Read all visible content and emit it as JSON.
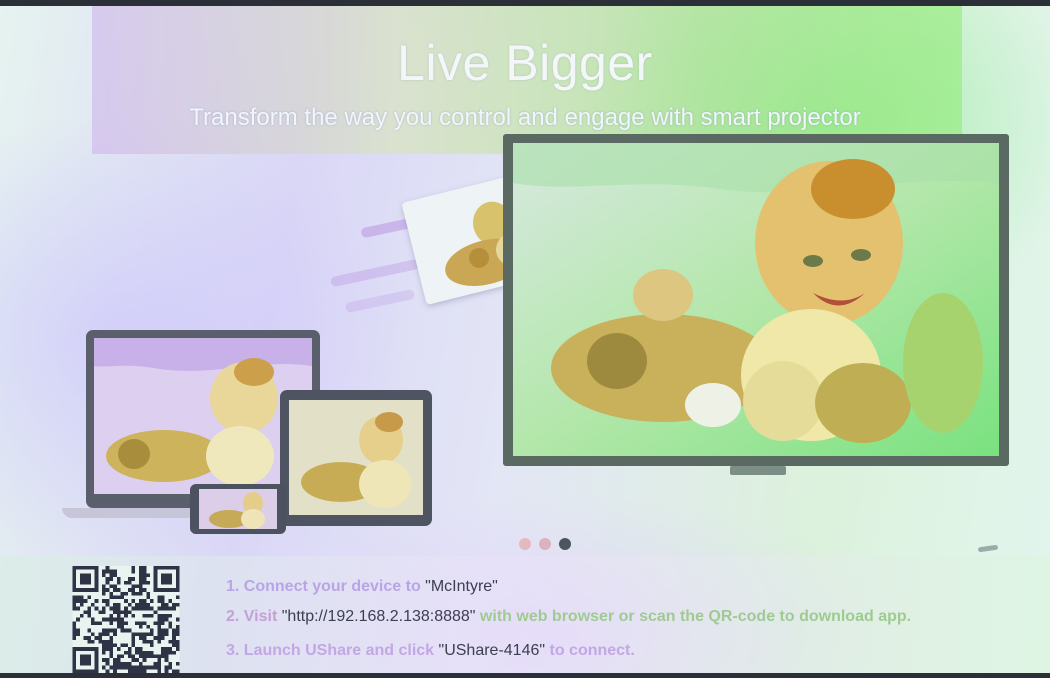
{
  "header": {
    "title": "Live Bigger",
    "subtitle": "Transform the way you control and engage with smart projector"
  },
  "carousel": {
    "slide_count": 3,
    "active_index": 2,
    "dot_colors": [
      "#e5b9c0",
      "#dcb2be",
      "#4b5661"
    ]
  },
  "instructions": {
    "step1": {
      "text": "1. Connect your device to ",
      "highlight": "\"McIntyre\""
    },
    "step2": {
      "text": "2. Visit ",
      "highlight": "\"http://192.168.2.138:8888\"",
      "tail": " with web browser or scan the QR-code to download app."
    },
    "step3": {
      "text": "3. Launch UShare and click ",
      "highlight": "\"UShare-4146\"",
      "tail": " to connect."
    }
  },
  "icons": {
    "qr": "qr-code-icon"
  },
  "colors": {
    "headline": "#f4f7fa",
    "green_tint": "#86e58c",
    "lavender_tint": "#c7b8ee"
  }
}
